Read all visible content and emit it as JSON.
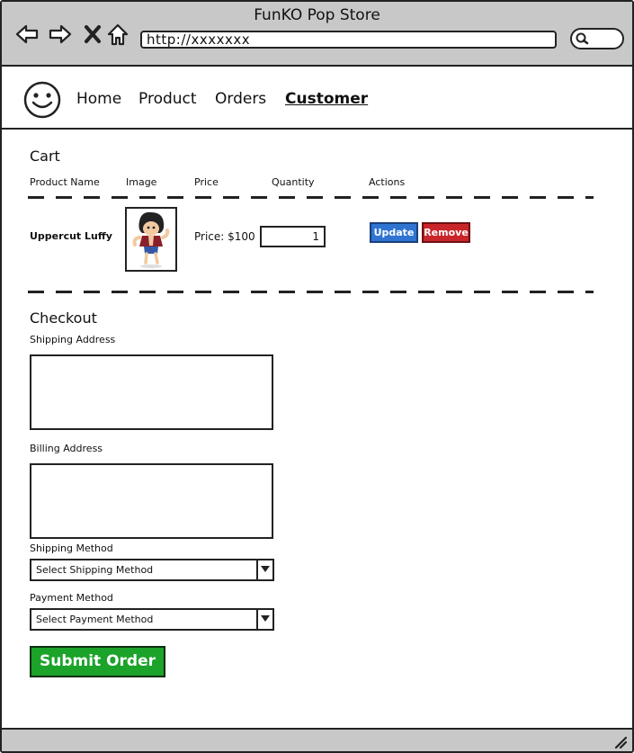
{
  "window": {
    "title": "FunKO Pop Store"
  },
  "browser": {
    "url": "http://xxxxxxx"
  },
  "nav": {
    "items": [
      {
        "label": "Home"
      },
      {
        "label": "Product"
      },
      {
        "label": "Orders"
      },
      {
        "label": "Customer",
        "active": true
      }
    ]
  },
  "cart": {
    "title": "Cart",
    "columns": [
      "Product Name",
      "Image",
      "Price",
      "Quantity",
      "Actions"
    ],
    "items": [
      {
        "name": "Uppercut Luffy",
        "price": "Price: $100",
        "quantity": "1",
        "update_label": "Update",
        "remove_label": "Remove"
      }
    ]
  },
  "checkout": {
    "title": "Checkout",
    "shipping_address_label": "Shipping Address",
    "billing_address_label": "Billing Address",
    "shipping_method_label": "Shipping Method",
    "shipping_method_value": "Select Shipping Method",
    "payment_method_label": "Payment Method",
    "payment_method_value": "Select Payment Method",
    "submit_label": "Submit Order"
  },
  "colors": {
    "update": "#2f74d0",
    "remove": "#c8262b",
    "submit": "#1ca32a",
    "chrome": "#c8c8c8"
  },
  "icons": [
    "back-arrow-icon",
    "forward-arrow-icon",
    "close-icon",
    "home-icon",
    "search-icon",
    "smiley-logo-icon",
    "resize-grip-icon",
    "dropdown-chevron-icon"
  ]
}
